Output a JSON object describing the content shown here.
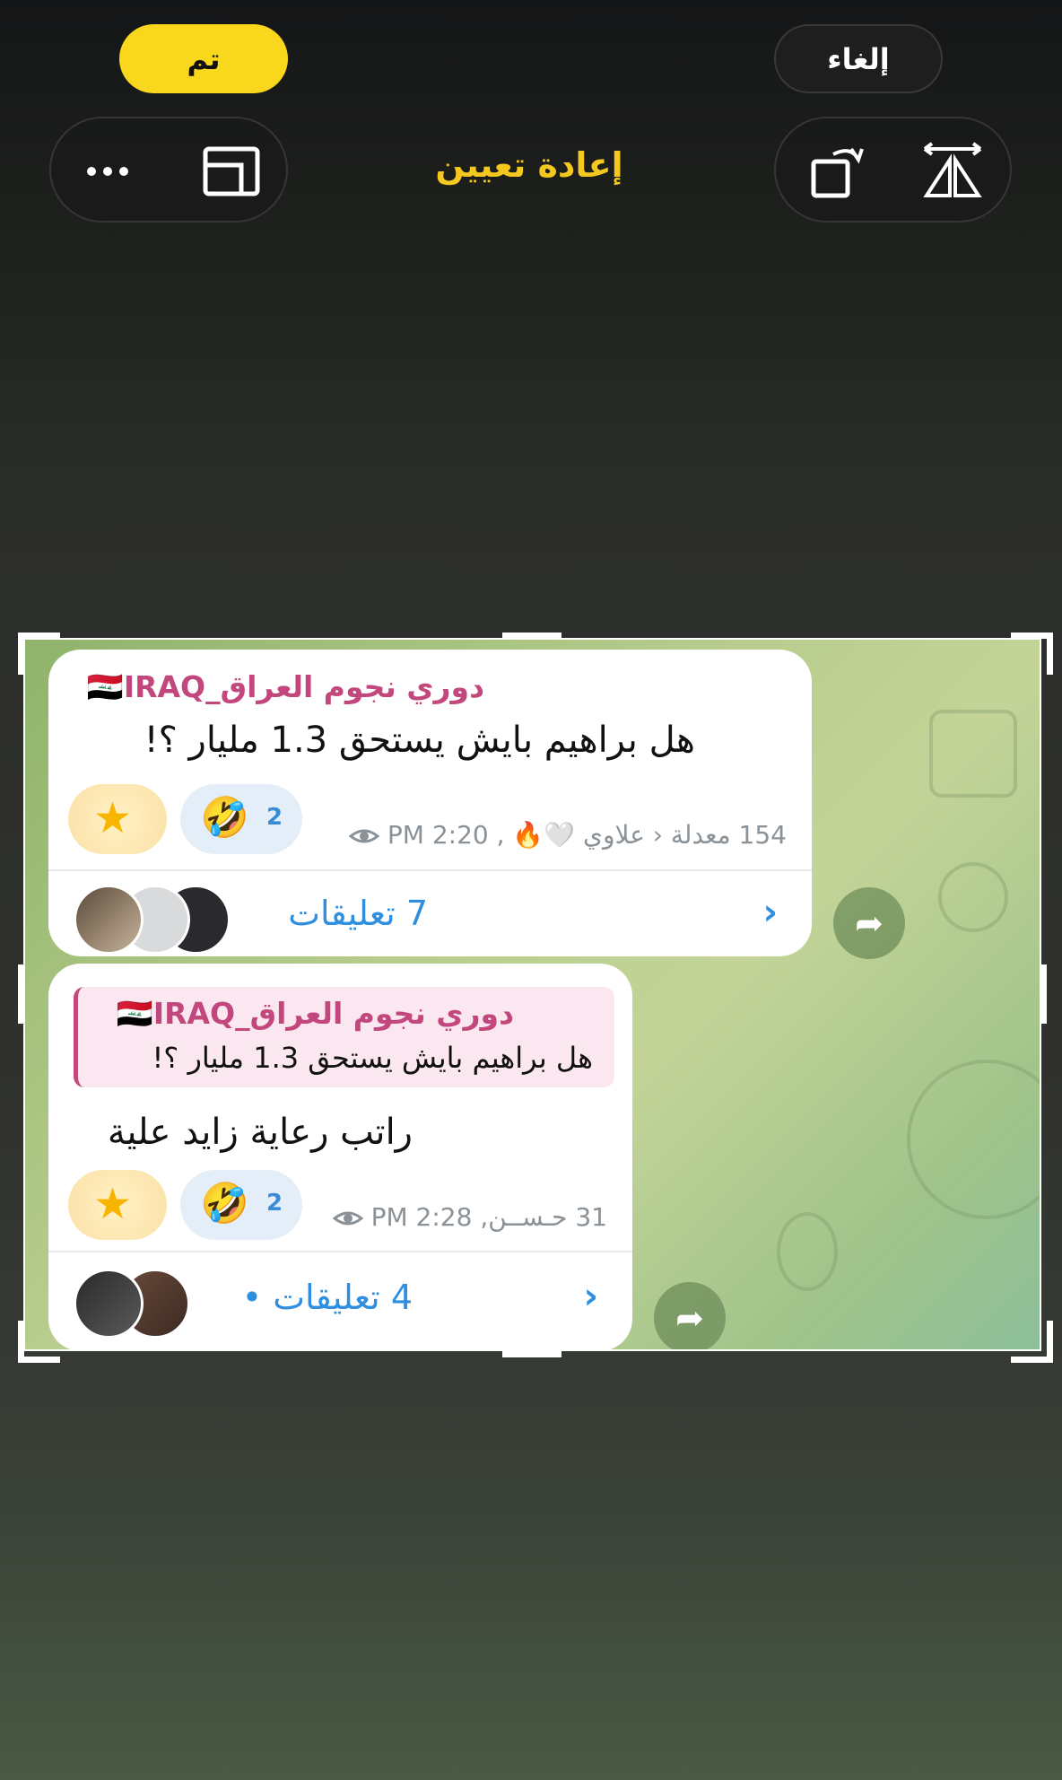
{
  "toolbar": {
    "cancel_label": "إلغاء",
    "done_label": "تم",
    "reset_label": "إعادة تعيين",
    "more_icon": "more-icon",
    "aspect_icon": "aspect-ratio-icon",
    "rotate_icon": "rotate-icon",
    "flip_icon": "flip-icon",
    "accent_color": "#f9d71c"
  },
  "messages": [
    {
      "channel": "دوري نجوم العراق_🇮🇶IRAQ",
      "text": "هل براهيم بايش يستحق 1.3 مليار ؟!",
      "reaction_emoji": "🤣",
      "reaction_count": "2",
      "meta": "154 معدلة ‹ علاوي 🤍🔥 , 2:20 PM",
      "comments": "7 تعليقات"
    },
    {
      "channel": "دوري نجوم العراق_🇮🇶IRAQ",
      "quote": "هل براهيم بايش يستحق 1.3 مليار ؟!",
      "text": "راتب رعاية زايد علية",
      "reaction_emoji": "🤣",
      "reaction_count": "2",
      "meta": "31 حـســن, 2:28 PM",
      "comments": "4 تعليقات •"
    }
  ]
}
